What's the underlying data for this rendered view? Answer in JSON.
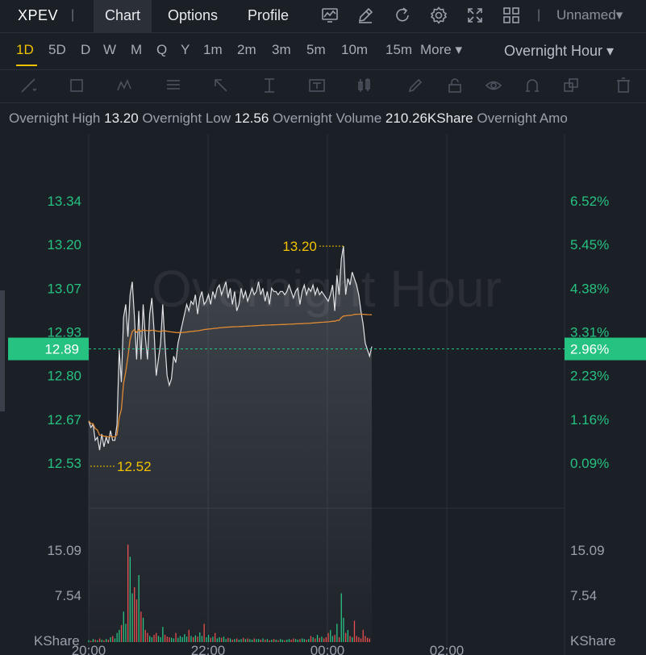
{
  "header": {
    "ticker": "XPEV",
    "tabs": [
      {
        "label": "Chart",
        "active": true
      },
      {
        "label": "Options",
        "active": false
      },
      {
        "label": "Profile",
        "active": false
      }
    ],
    "icons": [
      "indicator-icon",
      "draw-icon",
      "refresh-icon",
      "settings-icon",
      "fullscreen-icon",
      "grid-layout-icon"
    ],
    "layout_name": "Unnamed▾"
  },
  "timeframes": {
    "items": [
      "1D",
      "5D",
      "D",
      "W",
      "M",
      "Q",
      "Y",
      "1m",
      "2m",
      "3m",
      "5m",
      "10m",
      "15m"
    ],
    "active": "1D",
    "more_label": "More ▾",
    "session_label": "Overnight Hour ▾"
  },
  "drawing_tools": [
    "line-tool-icon",
    "rectangle-tool-icon",
    "pattern-tool-icon",
    "fibonacci-tool-icon",
    "arrow-tool-icon",
    "measure-tool-icon",
    "text-tool-icon",
    "candles-tool-icon",
    "brush-icon",
    "lock-icon",
    "eye-icon",
    "magnet-icon",
    "duplicate-icon",
    "trash-icon"
  ],
  "info": {
    "high_label": "Overnight High",
    "high_value": "13.20",
    "low_label": "Overnight Low",
    "low_value": "12.56",
    "volume_label": "Overnight Volume",
    "volume_value": "210.26KShare",
    "amount_label": "Overnight Amo"
  },
  "chart_data": {
    "type": "line",
    "watermark": "Overnight Hour",
    "price_axis_left": [
      "13.34",
      "13.20",
      "13.07",
      "12.93",
      "12.80",
      "12.67",
      "12.53"
    ],
    "pct_axis_right": [
      "6.52%",
      "5.45%",
      "4.38%",
      "3.31%",
      "2.23%",
      "1.16%",
      "0.09%"
    ],
    "ylim": [
      12.53,
      13.34
    ],
    "current_price": "12.89",
    "current_pct": "2.96%",
    "high_marker": "13.20",
    "low_marker": "12.52",
    "x_labels": [
      "20:00",
      "22:00",
      "00:00",
      "02:00"
    ],
    "volume_axis": [
      "15.09",
      "7.54",
      "KShare"
    ],
    "colors": {
      "up": "#26c281",
      "down": "#e94b4b",
      "price_line": "#e0e2e6",
      "avg_line": "#e08a33",
      "marker": "#f2c200",
      "badge": "#26c281"
    },
    "price_series": [
      12.66,
      12.64,
      12.65,
      12.6,
      12.61,
      12.57,
      12.62,
      12.58,
      12.61,
      12.59,
      12.63,
      12.6,
      12.6,
      12.65,
      12.88,
      12.78,
      12.98,
      13.02,
      12.92,
      13.05,
      13.09,
      12.98,
      12.85,
      13.0,
      12.85,
      13.02,
      12.92,
      12.85,
      12.99,
      13.04,
      12.94,
      12.8,
      12.85,
      12.9,
      13.02,
      12.9,
      12.8,
      12.77,
      12.79,
      12.86,
      12.84,
      12.9,
      12.93,
      12.96,
      12.99,
      13.02,
      13.0,
      13.03,
      13.02,
      13.05,
      12.99,
      13.04,
      13.06,
      13.02,
      13.03,
      13.05,
      13.02,
      13.06,
      13.04,
      13.07,
      13.08,
      13.05,
      13.07,
      13.09,
      13.04,
      13.07,
      13.02,
      13.06,
      13.0,
      13.02,
      13.07,
      13.04,
      13.06,
      13.03,
      13.05,
      13.07,
      13.05,
      13.06,
      13.09,
      13.05,
      13.07,
      13.03,
      13.06,
      13.02,
      13.07,
      13.06,
      13.06,
      13.05,
      13.06,
      13.06,
      13.05,
      13.06,
      13.08,
      13.06,
      13.04,
      13.06,
      13.07,
      13.02,
      13.06,
      13.08,
      13.05,
      13.07,
      13.06,
      13.08,
      13.05,
      13.07,
      13.05,
      13.06,
      13.05,
      13.04,
      13.03,
      13.05,
      13.08,
      13.0,
      13.11,
      13.05,
      13.16,
      13.2,
      13.05,
      13.1,
      13.08,
      13.12,
      13.1,
      13.08,
      13.05,
      13.0,
      12.96,
      12.9,
      12.88,
      12.86,
      12.89
    ],
    "volume_series": [
      0.3,
      0.2,
      0.5,
      0.4,
      0.3,
      0.6,
      0.4,
      0.3,
      0.5,
      0.4,
      0.8,
      1.0,
      0.6,
      1.5,
      2.0,
      2.8,
      5.0,
      3.0,
      16.0,
      14.0,
      8.0,
      9.0,
      7.0,
      11.0,
      5.0,
      4.0,
      2.0,
      1.5,
      1.0,
      0.8,
      1.2,
      1.5,
      1.0,
      0.8,
      2.5,
      1.2,
      0.9,
      0.8,
      0.7,
      0.6,
      1.5,
      0.7,
      1.0,
      0.8,
      1.3,
      0.9,
      2.0,
      1.0,
      0.8,
      1.1,
      0.9,
      1.6,
      1.0,
      3.0,
      0.8,
      1.2,
      0.7,
      0.9,
      1.5,
      0.6,
      0.8,
      0.7,
      0.9,
      0.5,
      0.7,
      0.6,
      0.4,
      0.5,
      0.6,
      0.4,
      0.5,
      0.7,
      0.5,
      0.6,
      0.5,
      0.4,
      0.6,
      0.5,
      0.5,
      0.4,
      0.6,
      0.4,
      0.5,
      0.3,
      0.4,
      0.5,
      0.4,
      0.3,
      0.5,
      0.4,
      0.3,
      0.4,
      0.5,
      0.4,
      0.6,
      0.5,
      0.4,
      0.5,
      0.6,
      0.5,
      0.4,
      0.5,
      1.0,
      0.8,
      0.6,
      1.2,
      0.7,
      0.9,
      0.6,
      0.8,
      1.5,
      2.0,
      1.0,
      1.2,
      3.0,
      0.8,
      8.0,
      4.0,
      1.5,
      2.0,
      1.0,
      0.8,
      3.5,
      1.0,
      0.8,
      0.6,
      2.0,
      1.0,
      0.7,
      0.6
    ]
  }
}
